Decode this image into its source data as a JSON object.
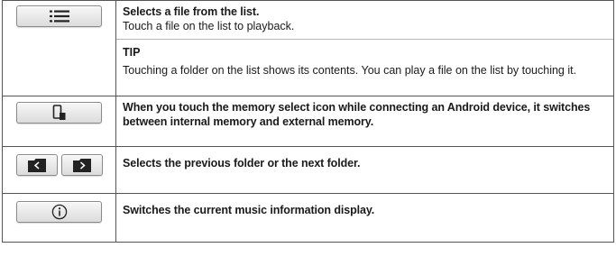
{
  "rows": [
    {
      "icon": "list-icon",
      "heading": "Selects a file from the list.",
      "body": "Touch a file on the list to playback.",
      "tip_label": "TIP",
      "tip_text": "Touching a folder on the list shows its contents. You can play a file on the list by touching it."
    },
    {
      "icon": "memory-select-icon",
      "heading": "When you touch the memory select icon while connecting an Android device, it switches between internal memory and external memory."
    },
    {
      "icons": [
        "previous-folder-icon",
        "next-folder-icon"
      ],
      "heading": "Selects the previous folder or the next folder."
    },
    {
      "icon": "info-icon",
      "heading": "Switches the current music information display."
    }
  ]
}
